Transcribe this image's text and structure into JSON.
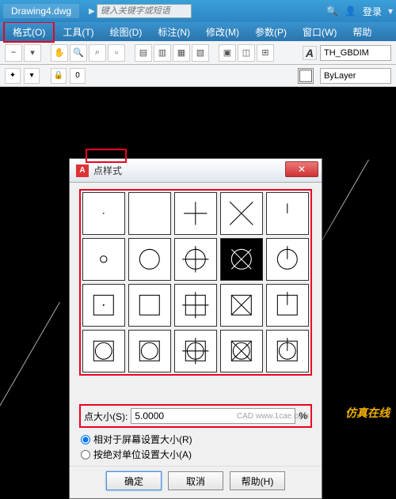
{
  "title_bar": {
    "document": "Drawing4.dwg",
    "search_placeholder": "键入关键字或短语",
    "login": "登录"
  },
  "menu": {
    "format": "格式(O)",
    "tools": "工具(T)",
    "draw": "绘图(D)",
    "dimension": "标注(N)",
    "modify": "修改(M)",
    "parametric": "参数(P)",
    "window": "窗口(W)",
    "help": "帮助"
  },
  "toolbar1": {
    "dim_style": "TH_GBDIM"
  },
  "toolbar2": {
    "layer": "ByLayer"
  },
  "dialog": {
    "title": "点样式",
    "size_label": "点大小(S):",
    "size_value": "5.0000",
    "size_unit": "%",
    "radio_screen": "相对于屏幕设置大小(R)",
    "radio_absolute": "按绝对单位设置大小(A)",
    "ok": "确定",
    "cancel": "取消",
    "help": "帮助(H)"
  },
  "watermark": {
    "main": "仿真在线",
    "sub": "CAD www.1cae.com"
  }
}
